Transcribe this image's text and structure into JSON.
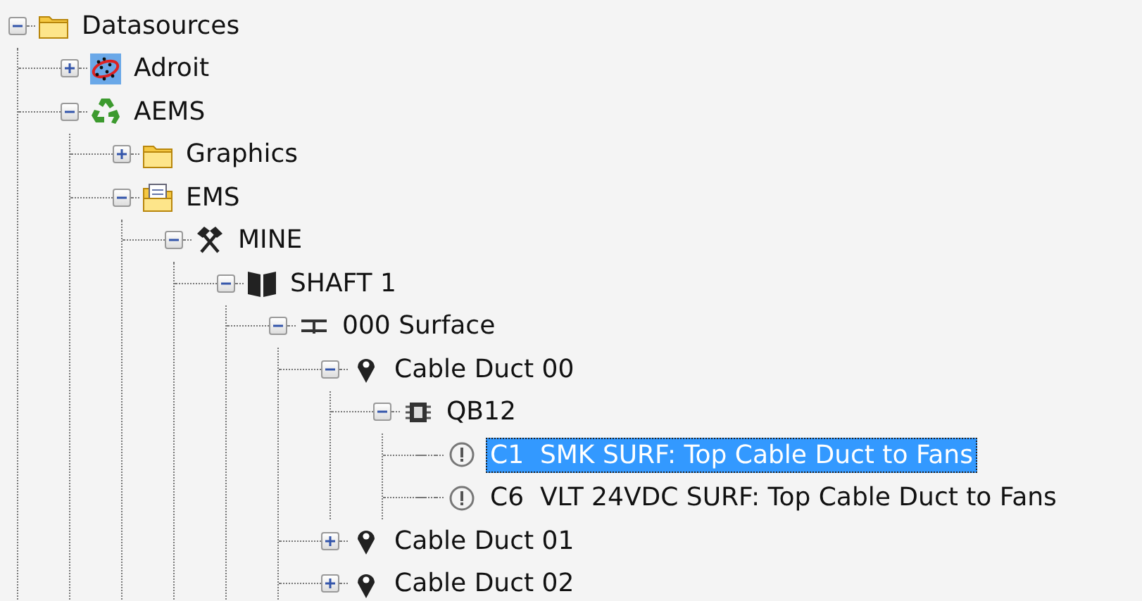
{
  "tree": [
    {
      "label": "Datasources",
      "kind": "folder",
      "expanded": true,
      "selected": false,
      "children": [
        {
          "label": "Adroit",
          "kind": "scatter",
          "expanded": false,
          "selected": false
        },
        {
          "label": "AEMS",
          "kind": "recycle",
          "expanded": true,
          "selected": false,
          "children": [
            {
              "label": "Graphics",
              "kind": "folder",
              "expanded": false,
              "selected": false
            },
            {
              "label": "EMS",
              "kind": "docfolder",
              "expanded": true,
              "selected": false,
              "children": [
                {
                  "label": "MINE",
                  "kind": "hammers",
                  "expanded": true,
                  "selected": false,
                  "children": [
                    {
                      "label": "SHAFT 1",
                      "kind": "book",
                      "expanded": true,
                      "selected": false,
                      "children": [
                        {
                          "label": "000 Surface",
                          "kind": "junction",
                          "expanded": true,
                          "selected": false,
                          "children": [
                            {
                              "label": "Cable Duct 00",
                              "kind": "pin",
                              "expanded": true,
                              "selected": false,
                              "children": [
                                {
                                  "label": "QB12",
                                  "kind": "chip",
                                  "expanded": true,
                                  "selected": false,
                                  "children": [
                                    {
                                      "label": "C1  SMK SURF: Top Cable Duct to Fans",
                                      "kind": "info",
                                      "selected": true
                                    },
                                    {
                                      "label": "C6  VLT 24VDC SURF: Top Cable Duct to Fans",
                                      "kind": "info",
                                      "selected": false
                                    }
                                  ]
                                }
                              ]
                            },
                            {
                              "label": "Cable Duct 01",
                              "kind": "pin",
                              "expanded": false,
                              "selected": false
                            },
                            {
                              "label": "Cable Duct 02",
                              "kind": "pin",
                              "expanded": false,
                              "selected": false
                            }
                          ]
                        }
                      ]
                    }
                  ]
                }
              ]
            }
          ]
        }
      ]
    }
  ]
}
